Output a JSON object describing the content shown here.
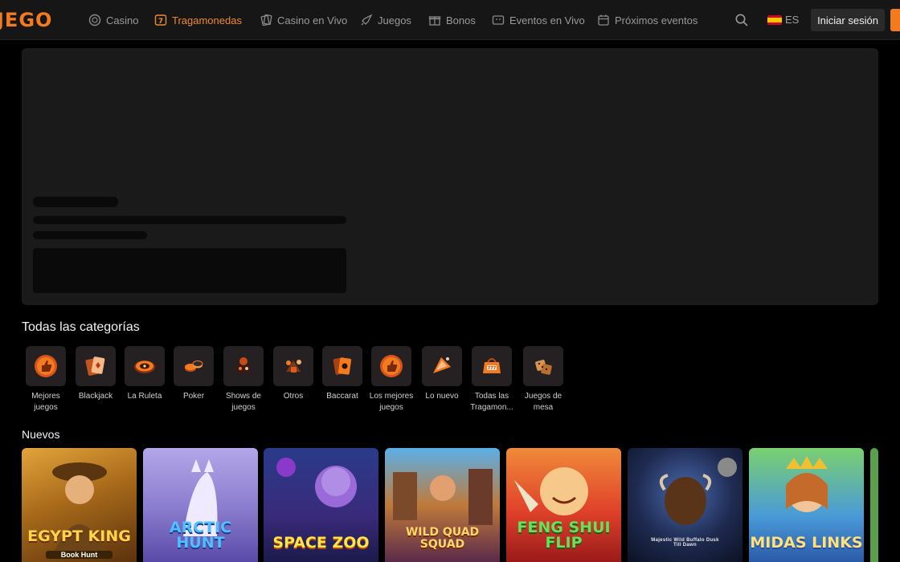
{
  "header": {
    "logo": "JEGO",
    "nav": [
      {
        "label": "Casino",
        "icon": "casino-chip-icon"
      },
      {
        "label": "Tragamonedas",
        "icon": "slot-machine-icon"
      },
      {
        "label": "Casino en Vivo",
        "icon": "live-cards-icon"
      },
      {
        "label": "Juegos",
        "icon": "rocket-icon"
      },
      {
        "label": "Bonos",
        "icon": "gift-icon"
      },
      {
        "label": "Eventos en Vivo",
        "icon": "live-tv-icon"
      },
      {
        "label": "Próximos eventos",
        "icon": "calendar-icon"
      }
    ],
    "active_nav": "Tragamonedas",
    "language": "ES",
    "login_label": "Iniciar sesión"
  },
  "categories": {
    "title": "Todas las categorías",
    "items": [
      {
        "label": "Mejores juegos",
        "icon": "thumbs-up-icon"
      },
      {
        "label": "Blackjack",
        "icon": "playing-cards-icon"
      },
      {
        "label": "La Ruleta",
        "icon": "roulette-icon"
      },
      {
        "label": "Poker",
        "icon": "poker-chips-icon"
      },
      {
        "label": "Shows de juegos",
        "icon": "game-show-icon"
      },
      {
        "label": "Otros",
        "icon": "misc-games-icon"
      },
      {
        "label": "Baccarat",
        "icon": "baccarat-cards-icon"
      },
      {
        "label": "Los mejores juegos",
        "icon": "thumbs-up-icon"
      },
      {
        "label": "Lo nuevo",
        "icon": "new-ticket-icon"
      },
      {
        "label": "Todas las Tragamon...",
        "icon": "slot-bag-icon"
      },
      {
        "label": "Juegos de mesa",
        "icon": "dice-icon"
      }
    ]
  },
  "nuevos": {
    "title": "Nuevos",
    "games": [
      {
        "title": "Egypt King",
        "subtitle": "Book Hunt"
      },
      {
        "title": "Arctic Hunt",
        "subtitle": ""
      },
      {
        "title": "Space Zoo",
        "subtitle": ""
      },
      {
        "title": "Wild Quad Squad",
        "subtitle": ""
      },
      {
        "title": "Feng Shui Flip",
        "subtitle": ""
      },
      {
        "title": "",
        "subtitle": "Majestic Wild Buffalo Dusk Till Dawn"
      },
      {
        "title": "Midas Links",
        "subtitle": ""
      }
    ]
  },
  "colors": {
    "accent": "#f47a1f",
    "header_bg": "#161616",
    "page_bg": "#000000",
    "skeleton_card": "#1a1a1a"
  }
}
